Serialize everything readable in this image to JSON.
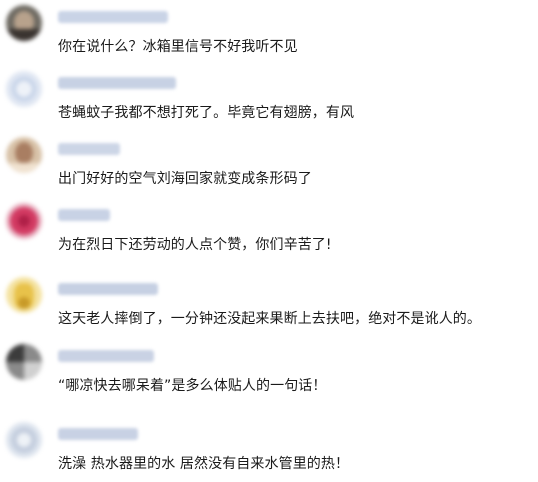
{
  "comments": [
    {
      "username": "",
      "text": "你在说什么？冰箱里信号不好我听不见",
      "avatar_colors": [
        "#6e6a62",
        "#b8a28c",
        "#3a3430"
      ],
      "name_color": "#c9d3e6"
    },
    {
      "username": "",
      "text": "苍蝇蚊子我都不想打死了。毕竟它有翅膀，有风",
      "avatar_colors": [
        "#dfe6f2",
        "#c5d2e8",
        "#eef2f8"
      ],
      "name_color": "#c7d1e4"
    },
    {
      "username": "",
      "text": "出门好好的空气刘海回家就变成条形码了",
      "avatar_colors": [
        "#d8c2a8",
        "#a97e62",
        "#f0e2d0"
      ],
      "name_color": "#ccd5e6"
    },
    {
      "username": "",
      "text": "为在烈日下还劳动的人点个赞，你们辛苦了!",
      "avatar_colors": [
        "#d23a62",
        "#e87890",
        "#b02048"
      ],
      "name_color": "#c8d2e5"
    },
    {
      "username": "",
      "text": "这天老人摔倒了，一分钟还没起来果断上去扶吧，绝对不是讹人的。",
      "avatar_colors": [
        "#e8c24a",
        "#c89a28",
        "#f4e2a0"
      ],
      "name_color": "#c6d0e3"
    },
    {
      "username": "",
      "text": "“哪凉快去哪呆着”是多么体贴人的一句话！",
      "avatar_colors": [
        "#3c3c3c",
        "#8a8a8a",
        "#d0d0d0"
      ],
      "name_color": "#c9d2e4"
    },
    {
      "username": "",
      "text": "洗澡 热水器里的水 居然没有自来水管里的热！",
      "avatar_colors": [
        "#dde4ee",
        "#c4cede",
        "#eef2f7"
      ],
      "name_color": "#c8d1e4"
    }
  ]
}
